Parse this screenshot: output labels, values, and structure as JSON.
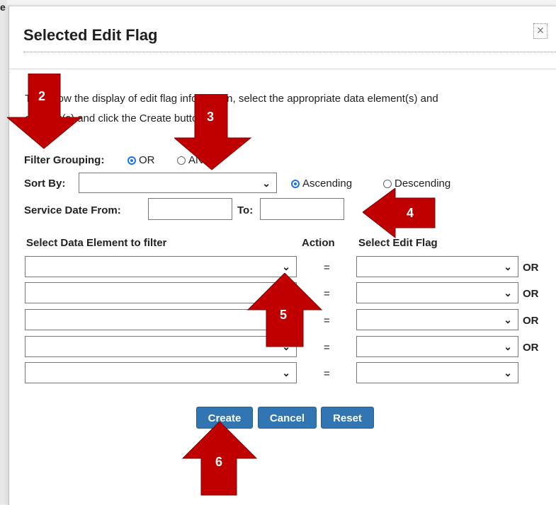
{
  "dialog": {
    "title": "Selected Edit Flag",
    "close_glyph": "×",
    "instructions_line1": "To narrow the display of edit flag information, select the appropriate data element(s) and",
    "instructions_line2": "edit flag(s) and click the Create button.",
    "help_icon": "question-circle-icon",
    "help_glyph": "?"
  },
  "filter_grouping": {
    "label": "Filter Grouping:",
    "options": [
      "OR",
      "AND"
    ],
    "selected": "OR"
  },
  "sort_by": {
    "label": "Sort By:",
    "value": "",
    "order_options": [
      "Ascending",
      "Descending"
    ],
    "selected_order": "Ascending"
  },
  "service_date": {
    "from_label": "Service Date From:",
    "to_label": "To:",
    "from_value": "",
    "to_value": ""
  },
  "filter_table": {
    "headers": {
      "element": "Select Data Element to filter",
      "action": "Action",
      "flag": "Select Edit Flag"
    },
    "rows": [
      {
        "element": "",
        "action": "=",
        "flag": "",
        "connector": "OR"
      },
      {
        "element": "",
        "action": "=",
        "flag": "",
        "connector": "OR"
      },
      {
        "element": "",
        "action": "=",
        "flag": "",
        "connector": "OR"
      },
      {
        "element": "",
        "action": "=",
        "flag": "",
        "connector": "OR"
      },
      {
        "element": "",
        "action": "=",
        "flag": "",
        "connector": ""
      }
    ]
  },
  "buttons": {
    "create": "Create",
    "cancel": "Cancel",
    "reset": "Reset"
  },
  "callouts": {
    "color": "#c00000",
    "numbers": [
      "2",
      "3",
      "4",
      "5",
      "6"
    ]
  },
  "background": {
    "edge_glyph": "e"
  }
}
